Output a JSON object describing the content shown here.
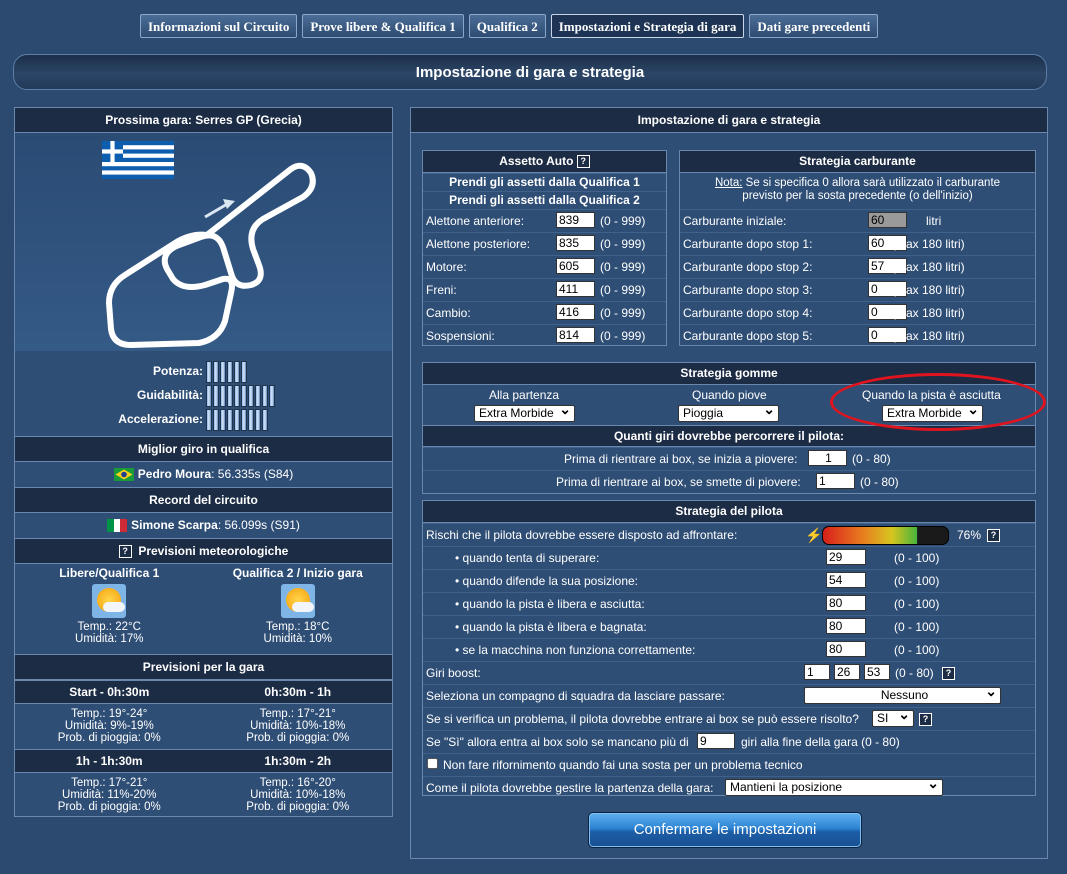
{
  "tabs": [
    "Informazioni sul Circuito",
    "Prove libere & Qualifica 1",
    "Qualifica 2",
    "Impostazioni e Strategia di gara",
    "Dati gare precedenti"
  ],
  "page_title": "Impostazione di gara e strategia",
  "left": {
    "next_race": "Prossima gara: Serres GP (Grecia)",
    "ratings": [
      {
        "label": "Potenza:",
        "level": 6
      },
      {
        "label": "Guidabilità:",
        "level": 10
      },
      {
        "label": "Accelerazione:",
        "level": 9
      }
    ],
    "best_quali_title": "Miglior giro in qualifica",
    "best_quali_driver": "Pedro Moura",
    "best_quali_time": ":  56.335s  (S84)",
    "record_title": "Record del circuito",
    "record_driver": "Simone Scarpa",
    "record_time": ":  56.099s  (S91)",
    "weather_title": "Previsioni meteorologiche",
    "weather": [
      {
        "label": "Libere/Qualifica 1",
        "temp": "Temp.: 22°C",
        "hum": "Umidità: 17%"
      },
      {
        "label": "Qualifica 2 / Inizio gara",
        "temp": "Temp.: 18°C",
        "hum": "Umidità: 10%"
      }
    ],
    "race_forecast_title": "Previsioni per la gara",
    "forecast": [
      {
        "label": "Start - 0h:30m",
        "temp": "Temp.: 19°-24°",
        "hum": "Umidità: 9%-19%",
        "rain": "Prob. di pioggia: 0%"
      },
      {
        "label": "0h:30m - 1h",
        "temp": "Temp.: 17°-21°",
        "hum": "Umidità: 10%-18%",
        "rain": "Prob. di pioggia: 0%"
      },
      {
        "label": "1h - 1h:30m",
        "temp": "Temp.: 17°-21°",
        "hum": "Umidità: 11%-20%",
        "rain": "Prob. di pioggia: 0%"
      },
      {
        "label": "1h:30m - 2h",
        "temp": "Temp.: 16°-20°",
        "hum": "Umidità: 10%-18%",
        "rain": "Prob. di pioggia: 0%"
      }
    ]
  },
  "right": {
    "title": "Impostazione di gara e strategia",
    "setup": {
      "title": "Assetto Auto",
      "link_q1": "Prendi gli assetti dalla Qualifica 1",
      "link_q2": "Prendi gli assetti dalla Qualifica 2",
      "rows": [
        {
          "label": "Alettone anteriore:",
          "value": "839",
          "range": "(0 - 999)"
        },
        {
          "label": "Alettone posteriore:",
          "value": "835",
          "range": "(0 - 999)"
        },
        {
          "label": "Motore:",
          "value": "605",
          "range": "(0 - 999)"
        },
        {
          "label": "Freni:",
          "value": "411",
          "range": "(0 - 999)"
        },
        {
          "label": "Cambio:",
          "value": "416",
          "range": "(0 - 999)"
        },
        {
          "label": "Sospensioni:",
          "value": "814",
          "range": "(0 - 999)"
        }
      ]
    },
    "fuel": {
      "title": "Strategia carburante",
      "note_label": "Nota:",
      "note_text": " Se si specifica 0 allora sarà utilizzato il carburante previsto per la sosta precedente (o dell'inizio)",
      "rows": [
        {
          "label": "Carburante iniziale:",
          "value": "60",
          "unit": "litri"
        },
        {
          "label": "Carburante dopo stop 1:",
          "value": "60",
          "unit": "(Max 180 litri)"
        },
        {
          "label": "Carburante dopo stop 2:",
          "value": "57",
          "unit": "(Max 180 litri)"
        },
        {
          "label": "Carburante dopo stop 3:",
          "value": "0",
          "unit": "(Max 180 litri)"
        },
        {
          "label": "Carburante dopo stop 4:",
          "value": "0",
          "unit": "(Max 180 litri)"
        },
        {
          "label": "Carburante dopo stop 5:",
          "value": "0",
          "unit": "(Max 180 litri)"
        }
      ]
    },
    "tyres": {
      "title": "Strategia gomme",
      "cols": [
        {
          "label": "Alla partenza",
          "value": "Extra Morbide"
        },
        {
          "label": "Quando piove",
          "value": "Pioggia"
        },
        {
          "label": "Quando la pista è asciutta",
          "value": "Extra Morbide"
        }
      ],
      "laps_title": "Quanti giri dovrebbe percorrere il pilota:",
      "laps": [
        {
          "label": "Prima di rientrare ai box, se inizia a piovere:",
          "value": "1",
          "range": "(0 - 80)"
        },
        {
          "label": "Prima di rientrare ai box, se smette di piovere:",
          "value": "1",
          "range": "(0 - 80)"
        }
      ]
    },
    "driver": {
      "title": "Strategia del pilota",
      "risk_label": "Rischi che il pilota dovrebbe essere disposto ad affrontare:",
      "risk_value": "76%",
      "risk_level": 0.76,
      "rows": [
        {
          "label": "• quando tenta di superare:",
          "value": "29",
          "range": "(0 - 100)"
        },
        {
          "label": "• quando difende la sua posizione:",
          "value": "54",
          "range": "(0 - 100)"
        },
        {
          "label": "• quando la pista è libera e asciutta:",
          "value": "80",
          "range": "(0 - 100)"
        },
        {
          "label": "• quando la pista è libera e bagnata:",
          "value": "80",
          "range": "(0 - 100)"
        },
        {
          "label": "• se la macchina non funziona correttamente:",
          "value": "80",
          "range": "(0 - 100)"
        }
      ],
      "boost_label": "Giri boost:",
      "boost": [
        "1",
        "26",
        "53"
      ],
      "boost_range": "(0 - 80)",
      "teammate_label": "Seleziona un compagno di squadra da lasciare passare:",
      "teammate_value": "Nessuno",
      "problem_label": "Se si verifica un problema, il pilota dovrebbe entrare ai box se può essere risolto?",
      "problem_value": "SI",
      "ifyes_label": "Se \"Sì\" allora entra ai box solo se mancano più di",
      "ifyes_value": "9",
      "ifyes_suffix": "giri alla fine della gara (0 - 80)",
      "nofuel_label": "Non fare rifornimento quando fai una sosta per un problema tecnico",
      "start_label": "Come il pilota dovrebbe gestire la partenza della gara:",
      "start_value": "Mantieni la posizione"
    },
    "confirm": "Confermare le impostazioni"
  },
  "colors": {
    "accent": "#2d84d3",
    "header_bg": "#1c2c44",
    "panel_bg": "#2f4e75",
    "highlight": "#e0141e"
  }
}
